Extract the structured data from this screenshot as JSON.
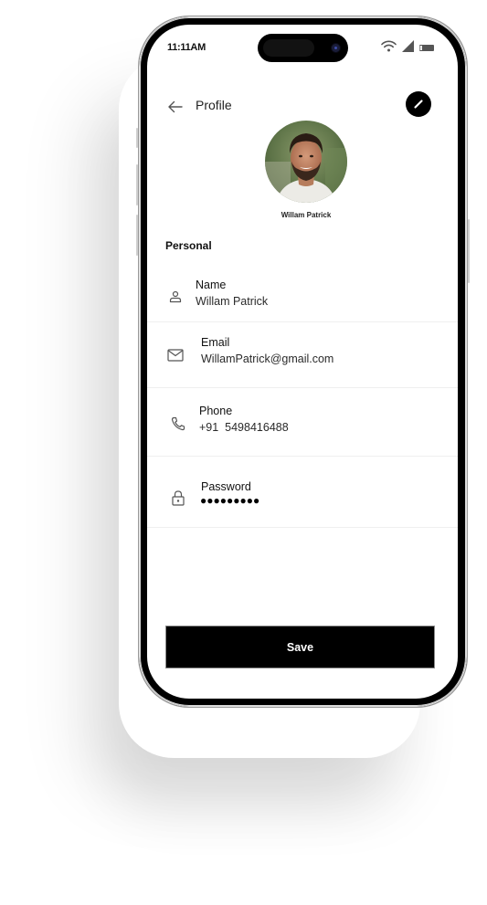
{
  "status_bar": {
    "time": "11:11AM",
    "icons": [
      "wifi-icon",
      "cellular-signal-icon",
      "battery-icon"
    ]
  },
  "header": {
    "back_icon": "arrow-left-icon",
    "title": "Profile",
    "edit_icon": "pencil-icon"
  },
  "profile": {
    "avatar": "profile-photo",
    "name": "Willam Patrick"
  },
  "section": {
    "title": "Personal"
  },
  "fields": [
    {
      "icon": "person-icon",
      "label": "Name",
      "value": "Willam Patrick"
    },
    {
      "icon": "mail-icon",
      "label": "Email",
      "value": "WillamPatrick@gmail.com"
    },
    {
      "icon": "phone-icon",
      "label": "Phone",
      "value": "+91  5498416488"
    },
    {
      "icon": "lock-icon",
      "label": "Password",
      "value": "●●●●●●●●●"
    }
  ],
  "save_button": {
    "label": "Save"
  },
  "colors": {
    "primary": "#000000",
    "background": "#ffffff",
    "divider": "#efefef",
    "icon": "#555555"
  }
}
